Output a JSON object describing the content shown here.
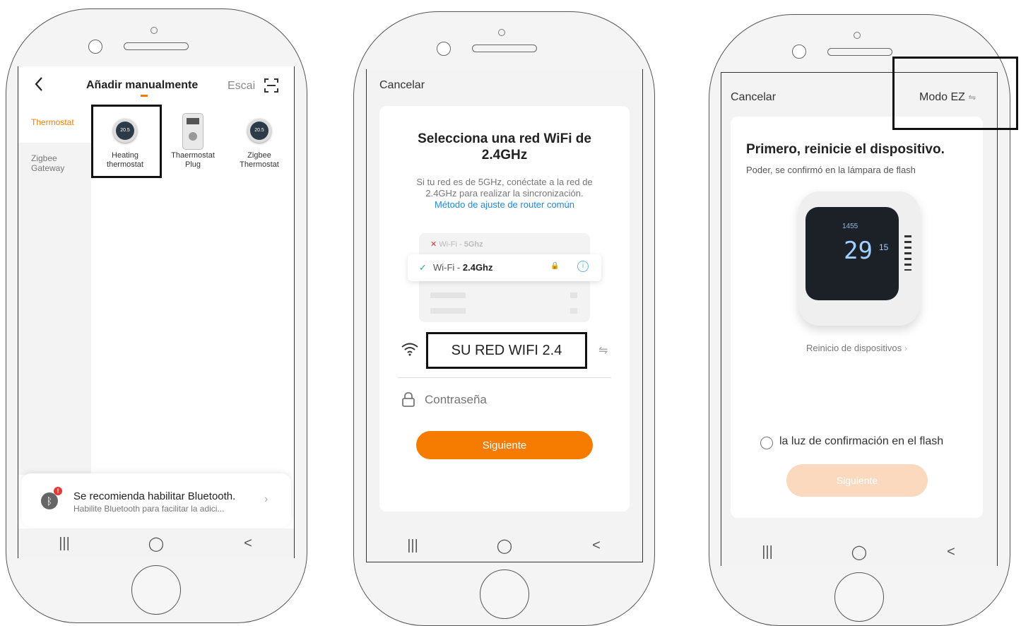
{
  "phone1": {
    "back_icon": "chevron-left-icon",
    "title": "Añadir manualmente",
    "scan_label": "Escai",
    "scan_icon": "scan-icon",
    "categories": [
      {
        "label": "Thermostat",
        "active": true
      },
      {
        "label": "Zigbee\nGateway",
        "active": false
      }
    ],
    "devices": [
      {
        "label": "Heating\nthermostat",
        "icon": "round-thermostat-icon",
        "display": "20.5"
      },
      {
        "label": "Thaermostat\nPlug",
        "icon": "plug-thermostat-icon"
      },
      {
        "label": "Zigbee\nThermostat",
        "icon": "round-thermostat-icon",
        "display": "20.5"
      }
    ],
    "bluetooth_title": "Se recomienda habilitar Bluetooth.",
    "bluetooth_subtitle": "Habilite Bluetooth para facilitar la adici...",
    "bluetooth_icon": "bluetooth-icon"
  },
  "phone2": {
    "cancel": "Cancelar",
    "heading": "Selecciona una red WiFi de 2.4GHz",
    "info": "Si tu red es de 5GHz, conéctate a la red de 2.4GHz para realizar la sincronización.",
    "link": "Método de ajuste de router común",
    "wifi5_prefix": "Wi-Fi - ",
    "wifi5_bold": "5Ghz",
    "wifi24_prefix": "Wi-Fi - ",
    "wifi24_bold": "2.4Ghz",
    "ssid": "SU RED WIFI 2.4",
    "password_placeholder": "Contraseña",
    "next": "Siguiente"
  },
  "phone3": {
    "cancel": "Cancelar",
    "mode": "Modo EZ",
    "heading": "Primero, reinicie el dispositivo.",
    "sub": "Poder, se confirmó en la lámpara de flash",
    "display_temp": "29",
    "display_small": "1455",
    "display_set": "15",
    "reset_link": "Reinicio de dispositivos",
    "confirm": "la luz de confirmación en el flash",
    "next": "Siguiente"
  },
  "nav": {
    "recent": "|||",
    "home": "◯",
    "back": "<"
  },
  "colors": {
    "accent": "#f57c00",
    "link": "#1e88e5",
    "disabled_btn": "#fbd9bf"
  }
}
